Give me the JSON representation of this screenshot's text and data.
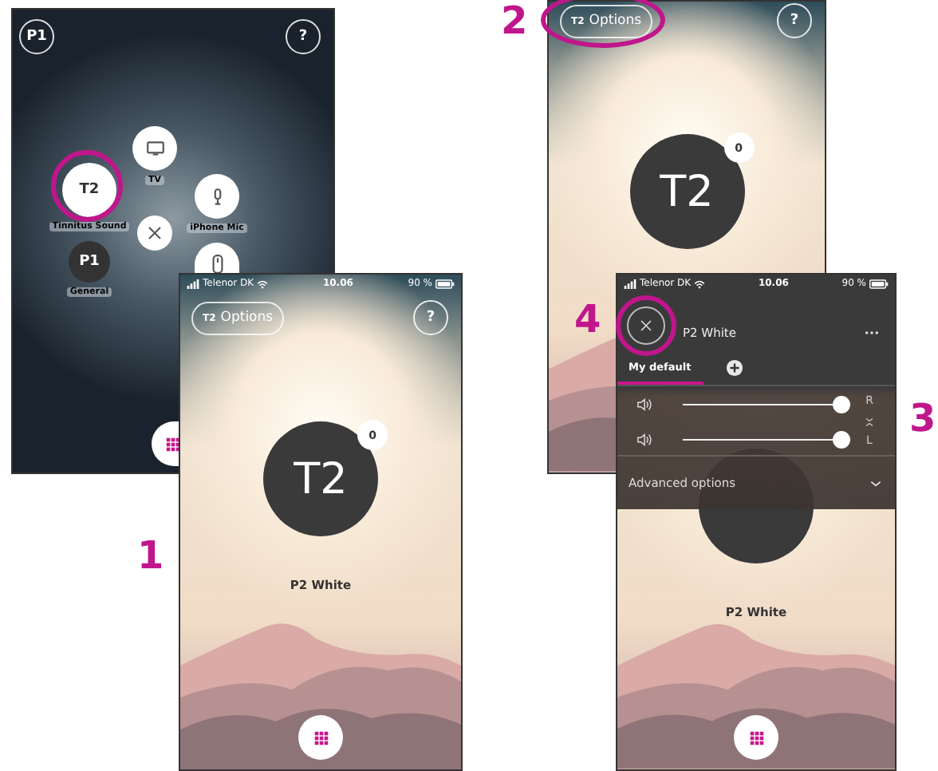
{
  "screens": [
    {
      "kind": "menu",
      "profile": "P1",
      "help": "?",
      "items": [
        {
          "kind": "tv",
          "label": "TV",
          "selected": false
        },
        {
          "kind": "text",
          "text": "T2",
          "label": "Tinnitus Sound",
          "selected": false
        },
        {
          "kind": "mic",
          "label": "iPhone Mic",
          "selected": false
        },
        {
          "kind": "text",
          "text": "P1",
          "label": "General",
          "selected": true
        },
        {
          "kind": "remote",
          "selected": false
        }
      ]
    },
    {
      "kind": "home",
      "status": {
        "carrier": "Telenor DK",
        "time": "10.06",
        "battery": "90 %"
      },
      "options": {
        "badge": "T2",
        "label": "Options"
      },
      "help": "?",
      "program": {
        "text": "T2",
        "count": "0",
        "name": "P2 White"
      }
    },
    {
      "kind": "home",
      "options": {
        "badge": "T2",
        "label": "Options"
      },
      "help": "?",
      "program": {
        "text": "T2",
        "count": "0"
      }
    },
    {
      "kind": "volume",
      "status": {
        "carrier": "Telenor DK",
        "time": "10.06",
        "battery": "90 %"
      },
      "title": "P2 White",
      "tabs": [
        {
          "label": "My default",
          "selected": true
        }
      ],
      "channels": [
        {
          "side": "R",
          "level": 0.96
        },
        {
          "side": "L",
          "level": 0.96
        }
      ],
      "advanced": "Advanced options",
      "program": {
        "name": "P2 White"
      }
    }
  ],
  "annotations": [
    {
      "label": "1"
    },
    {
      "label": "2"
    },
    {
      "label": "3"
    },
    {
      "label": "4"
    }
  ]
}
